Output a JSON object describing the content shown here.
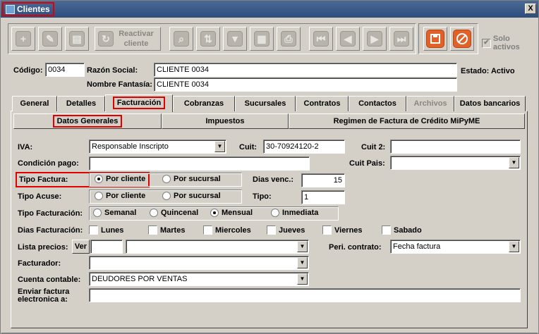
{
  "window": {
    "title": "Clientes",
    "close_label": "X"
  },
  "toolbar": {
    "reactivar_label_1": "Reactivar",
    "reactivar_label_2": "cliente",
    "solo_activos_label": "Solo activos",
    "solo_activos_checked": true
  },
  "header": {
    "codigo_label": "Código:",
    "codigo_value": "0034",
    "razon_label": "Razón Social:",
    "razon_value": "CLIENTE 0034",
    "fantasia_label": "Nombre Fantasía:",
    "fantasia_value": "CLIENTE 0034",
    "estado_text": "Estado: Activo"
  },
  "tabs": [
    {
      "label": "General"
    },
    {
      "label": "Detalles"
    },
    {
      "label": "Facturación"
    },
    {
      "label": "Cobranzas"
    },
    {
      "label": "Sucursales"
    },
    {
      "label": "Contratos"
    },
    {
      "label": "Contactos"
    },
    {
      "label": "Archivos"
    },
    {
      "label": "Datos bancarios"
    }
  ],
  "subtabs": [
    {
      "label": "Datos Generales"
    },
    {
      "label": "Impuestos"
    },
    {
      "label": "Regimen de Factura de Crédito MiPyME"
    }
  ],
  "form": {
    "iva_label": "IVA:",
    "iva_value": "Responsable Inscripto",
    "cuit_label": "Cuit:",
    "cuit_value": "30-70924120-2",
    "cuit2_label": "Cuit 2:",
    "cuit2_value": "",
    "condicion_label": "Condición pago:",
    "condicion_value": "",
    "cuitpais_label": "Cuit Pais:",
    "cuitpais_value": "",
    "tipo_factura_label": "Tipo Factura:",
    "por_cliente_label": "Por cliente",
    "por_sucursal_label": "Por sucursal",
    "dias_venc_label": "Dias venc.:",
    "dias_venc_value": "15",
    "tipo_acuse_label": "Tipo Acuse:",
    "tipo_label": "Tipo:",
    "tipo_value": "1",
    "tipo_facturacion_label": "Tipo Facturación:",
    "semanal_label": "Semanal",
    "quincenal_label": "Quincenal",
    "mensual_label": "Mensual",
    "inmediata_label": "Inmediata",
    "dias_facturacion_label": "Dias Facturación:",
    "lunes": "Lunes",
    "martes": "Martes",
    "miercoles": "Miercoles",
    "jueves": "Jueves",
    "viernes": "Viernes",
    "sabado": "Sabado",
    "lista_precios_label": "Lista precios:",
    "ver_label": "Ver",
    "lista_code_value": "",
    "lista_value": "",
    "peri_contrato_label": "Peri. contrato:",
    "peri_contrato_value": "Fecha factura",
    "facturador_label": "Facturador:",
    "facturador_value": "",
    "cuenta_label": "Cuenta contable:",
    "cuenta_value": "DEUDORES POR VENTAS",
    "enviar_label_1": "Enviar factura",
    "enviar_label_2": "electronica a:",
    "enviar_value": ""
  },
  "icons": {
    "new": "plus-icon",
    "edit": "pencil-icon",
    "delete": "delete-icon",
    "search": "search-icon",
    "sort": "sort-icon",
    "filter": "filter-icon",
    "export": "export-icon",
    "print": "print-icon",
    "first": "first-icon",
    "prev": "prev-icon",
    "next": "next-icon",
    "last": "last-icon",
    "save": "save-icon",
    "cancel": "cancel-icon"
  },
  "colors": {
    "highlight": "#e00000",
    "accent_orange": "#e0622a",
    "title_bar": "#2e4c7c"
  }
}
